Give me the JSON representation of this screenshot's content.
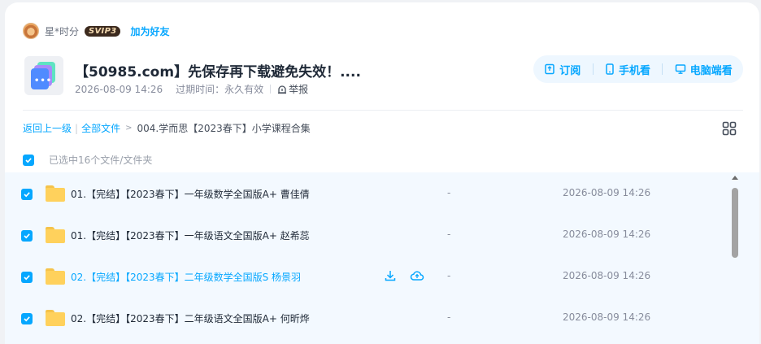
{
  "user": {
    "name": "星*时分",
    "badge": "SVIP3",
    "add_friend": "加为好友"
  },
  "share": {
    "title": "【50985.com】先保存再下载避免失效！....",
    "date": "2026-08-09 14:26",
    "expiry_label": "过期时间：永久有效",
    "report": "举报"
  },
  "actions": {
    "subscribe": "订阅",
    "mobile": "手机看",
    "pc": "电脑端看"
  },
  "breadcrumb": {
    "back": "返回上一级",
    "all_files": "全部文件",
    "current": "004.学而思【2023春下】小学课程合集"
  },
  "selection": {
    "text": "已选中16个文件/文件夹"
  },
  "files": [
    {
      "name": "01.【完结】【2023春下】一年级数学全国版A+ 曹佳倩",
      "size": "-",
      "time": "2026-08-09 14:26"
    },
    {
      "name": "01.【完结】【2023春下】一年级语文全国版A+ 赵希蕊",
      "size": "-",
      "time": "2026-08-09 14:26"
    },
    {
      "name": "02.【完结】【2023春下】二年级数学全国版S 杨景羽",
      "size": "-",
      "time": "2026-08-09 14:26"
    },
    {
      "name": "02.【完结】【2023春下】二年级语文全国版A+ 何昕烨",
      "size": "-",
      "time": "2026-08-09 14:26"
    }
  ],
  "colors": {
    "accent": "#06a7ff",
    "row_bg": "#f3f9ff",
    "folder": "#ffd15c"
  },
  "icons": [
    "avatar-icon",
    "report-icon",
    "subscribe-icon",
    "mobile-icon",
    "pc-icon",
    "grid-view-icon",
    "checkbox-icon",
    "folder-icon",
    "download-icon",
    "save-to-cloud-icon"
  ]
}
